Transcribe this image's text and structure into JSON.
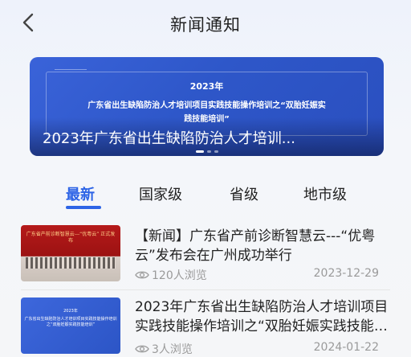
{
  "header": {
    "title": "新闻通知",
    "back_icon": "chevron-left-icon"
  },
  "banner": {
    "year": "2023年",
    "line1": "广东省出生缺陷防治人才培训项目实践技能操作培训之“双胎妊娠实",
    "line2": "践技能培训”",
    "caption": "2023年广东省出生缺陷防治人才培训...",
    "slide_count": 3,
    "active_slide": 0
  },
  "tabs": [
    {
      "label": "最新",
      "active": true
    },
    {
      "label": "国家级",
      "active": false
    },
    {
      "label": "省级",
      "active": false
    },
    {
      "label": "地市级",
      "active": false
    }
  ],
  "news": [
    {
      "title": "【新闻】广东省产前诊断智慧云---“优粤云”发布会在广州成功举行",
      "views": "120人浏览",
      "date": "2023-12-29",
      "thumb_text": "广东省产前诊断智慧云---“优粤云” 正式发布"
    },
    {
      "title": "2023年广东省出生缺陷防治人才培训项目实践技能操作培训之“双胎妊娠实践技能培训”",
      "views": "3人浏览",
      "date": "2024-01-22",
      "thumb_lines": [
        "2023年",
        "广东省出生缺陷防治人才培训项目实践技能操作培训之“双胎妊娠实践技能培训”"
      ]
    }
  ],
  "colors": {
    "accent": "#2d64e6",
    "banner_bg": "#2f58ca",
    "muted_text": "#9a9a9a"
  }
}
